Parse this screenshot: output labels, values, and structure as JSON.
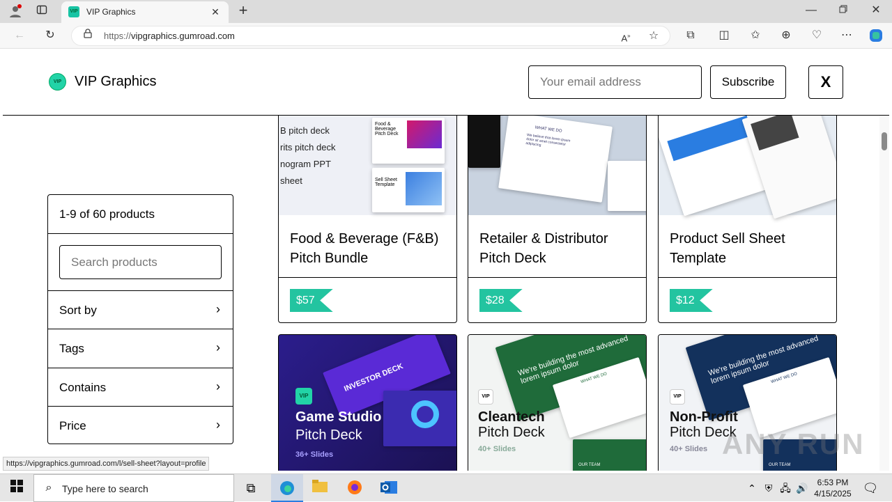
{
  "browser": {
    "tab_title": "VIP Graphics",
    "favicon_text": "VIP",
    "new_tab": "+",
    "url_prefix": "https://",
    "url_host": "vipgraphics.gumroad.com",
    "status_url": "https://vipgraphics.gumroad.com/l/sell-sheet?layout=profile"
  },
  "site": {
    "logo_text": "VIP",
    "name": "VIP Graphics",
    "email_placeholder": "Your email address",
    "subscribe_label": "Subscribe",
    "x_label": "X"
  },
  "filters": {
    "count": "1-9 of 60 products",
    "search_placeholder": "Search products",
    "items": [
      {
        "label": "Sort by"
      },
      {
        "label": "Tags"
      },
      {
        "label": "Contains"
      },
      {
        "label": "Price"
      }
    ]
  },
  "products_row1": [
    {
      "title": "Food & Beverage (F&B) Pitch Bundle",
      "price": "$57",
      "thumb_lines": [
        "B pitch deck",
        "rits pitch deck",
        "nogram PPT",
        "sheet"
      ],
      "thumb_slide1": "Food & Beverage Pitch Deck",
      "thumb_slide2": "Sell Sheet Template"
    },
    {
      "title": "Retailer & Distributor Pitch Deck",
      "price": "$28",
      "thumb_heading": "WHAT WE DO",
      "thumb_body": "We believe that lorem ipsum dolor sit amet consectetur adipiscing"
    },
    {
      "title": "Product Sell Sheet Template",
      "price": "$12"
    }
  ],
  "products_row2": [
    {
      "line1": "Game Studio",
      "line2": "Pitch Deck",
      "slides": "36+ Slides",
      "banner": "INVESTOR DECK",
      "badge": "VIP"
    },
    {
      "line1": "Cleantech",
      "line2": "Pitch Deck",
      "slides": "40+ Slides",
      "banner": "We're building the most advanced lorem ipsum dolor",
      "badge": "VIP",
      "slide_heading": "WHAT WE DO",
      "team": "OUR TEAM"
    },
    {
      "line1": "Non-Profit",
      "line2": "Pitch Deck",
      "slides": "40+ Slides",
      "banner": "We're building the most advanced lorem ipsum dolor",
      "badge": "VIP",
      "slide_heading": "WHAT WE DO",
      "team": "OUR TEAM"
    }
  ],
  "taskbar": {
    "search_placeholder": "Type here to search",
    "time": "6:53 PM",
    "date": "4/15/2025"
  },
  "watermark": "ANY RUN"
}
